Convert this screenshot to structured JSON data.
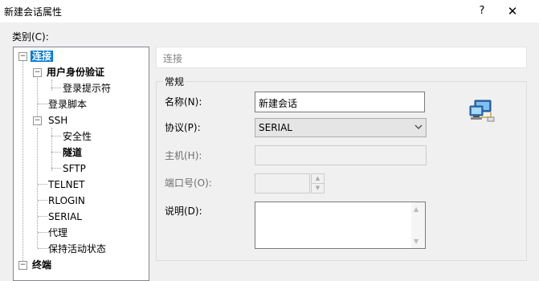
{
  "window": {
    "title": "新建会话属性",
    "help_label": "?",
    "close_label": "✕"
  },
  "category_label": "类别(C):",
  "tree": {
    "connection": "连接",
    "user_auth": "用户身份验证",
    "login_prompt": "登录提示符",
    "login_script": "登录脚本",
    "ssh": "SSH",
    "security": "安全性",
    "tunnel": "隧道",
    "sftp": "SFTP",
    "telnet": "TELNET",
    "rlogin": "RLOGIN",
    "serial": "SERIAL",
    "proxy": "代理",
    "keepalive": "保持活动状态",
    "terminal": "终端",
    "expand_minus": "−",
    "expand_plus": "+"
  },
  "panel_header": "连接",
  "group_title": "常规",
  "fields": {
    "name_label": "名称(N):",
    "name_value": "新建会话",
    "protocol_label": "协议(P):",
    "protocol_value": "SERIAL",
    "host_label": "主机(H):",
    "port_label": "端口号(O):",
    "desc_label": "说明(D):"
  },
  "colors": {
    "selection": "#0078d7",
    "background": "#f0f0f0"
  },
  "icons": {
    "network_computer": "network-computer-icon",
    "dropdown": "chevron-down-icon"
  }
}
